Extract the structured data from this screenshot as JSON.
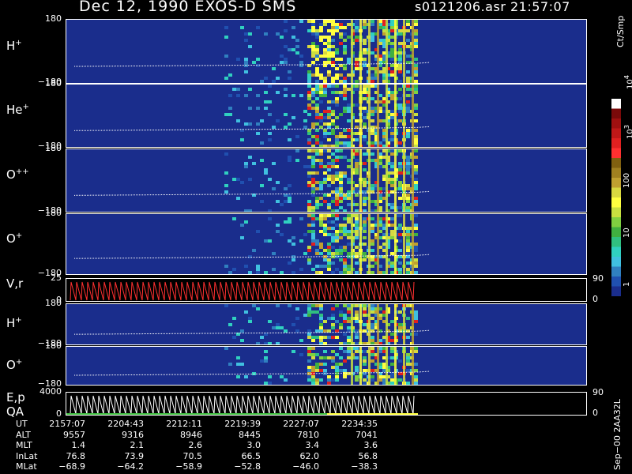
{
  "header": {
    "title_left": "Dec 12, 1990    EXOS-D SMS",
    "title_right": "s0121206.asr  21:57:07"
  },
  "panels": [
    {
      "key": "h_plus_1",
      "label": "H",
      "sup": "+",
      "y_top": "180",
      "y_bottom": "−180",
      "type": "spectrogram"
    },
    {
      "key": "he_plus",
      "label": "He",
      "sup": "+",
      "y_top": "180",
      "y_bottom": "−180",
      "type": "spectrogram"
    },
    {
      "key": "o_pp",
      "label": "O",
      "sup": "++",
      "y_top": "180",
      "y_bottom": "−180",
      "type": "spectrogram"
    },
    {
      "key": "o_plus_1",
      "label": "O",
      "sup": "+",
      "y_top": "180",
      "y_bottom": "−180",
      "type": "spectrogram"
    },
    {
      "key": "vr",
      "label": "V,r",
      "sup": "",
      "y_top": "25",
      "y_bottom": "0",
      "right_top": "90",
      "right_bottom": "0",
      "type": "sawtooth"
    },
    {
      "key": "h_plus_2",
      "label": "H",
      "sup": "+",
      "y_top": "180",
      "y_bottom": "−180",
      "type": "spectrogram"
    },
    {
      "key": "o_plus_2",
      "label": "O",
      "sup": "+",
      "y_top": "180",
      "y_bottom": "−180",
      "type": "spectrogram"
    },
    {
      "key": "ep",
      "label": "E,p",
      "label2": "QA",
      "sup": "",
      "y_top": "4000",
      "y_bottom": "0",
      "right_top": "90",
      "right_bottom": "0",
      "type": "sawtooth"
    }
  ],
  "colorbar": {
    "label": "Ct/Smp",
    "ticks": [
      {
        "label": "10",
        "sup": "4",
        "frac": 0.0
      },
      {
        "label": "10",
        "sup": "3",
        "frac": 0.25
      },
      {
        "label": "100",
        "frac": 0.5
      },
      {
        "label": "10",
        "frac": 0.75
      },
      {
        "label": "1",
        "frac": 1.0
      }
    ],
    "colors": [
      "#ffffff",
      "#7a0a0a",
      "#a01010",
      "#c01818",
      "#e02020",
      "#ff3030",
      "#806010",
      "#a08020",
      "#c0a030",
      "#d8d840",
      "#ffff40",
      "#c8e040",
      "#80d040",
      "#40b040",
      "#30c080",
      "#30d0c0",
      "#40c0e0",
      "#3080c0",
      "#2050b0",
      "#1a2d8c"
    ]
  },
  "chart_data": {
    "type": "heatmap",
    "title": "Dec 12, 1990    EXOS-D SMS",
    "colorbar_label": "Ct/Smp",
    "panels": [
      "H+",
      "He+",
      "O++",
      "O+",
      "V,r",
      "H+",
      "O+",
      "E,p QA"
    ],
    "pitch_angle_range": [
      -180,
      180
    ],
    "vr_range": [
      0,
      25
    ],
    "ep_range": [
      0,
      4000
    ],
    "time_ticks": [
      "2157:07",
      "2204:43",
      "2212:11",
      "2219:39",
      "2227:07",
      "2234:35"
    ]
  },
  "footer": {
    "rows": [
      {
        "label": "UT",
        "values": [
          "2157:07",
          "2204:43",
          "2212:11",
          "2219:39",
          "2227:07",
          "2234:35"
        ]
      },
      {
        "label": "ALT",
        "values": [
          "9557",
          "9316",
          "8946",
          "8445",
          "7810",
          "7041"
        ]
      },
      {
        "label": "MLT",
        "values": [
          "1.4",
          "2.1",
          "2.6",
          "3.0",
          "3.4",
          "3.6"
        ]
      },
      {
        "label": "InLat",
        "values": [
          "76.8",
          "73.9",
          "70.5",
          "66.5",
          "62.0",
          "56.8"
        ]
      },
      {
        "label": "MLat",
        "values": [
          "−68.9",
          "−64.2",
          "−58.9",
          "−52.8",
          "−46.0",
          "−38.3"
        ]
      }
    ],
    "side_note": "Sep−00 2AA32L"
  }
}
